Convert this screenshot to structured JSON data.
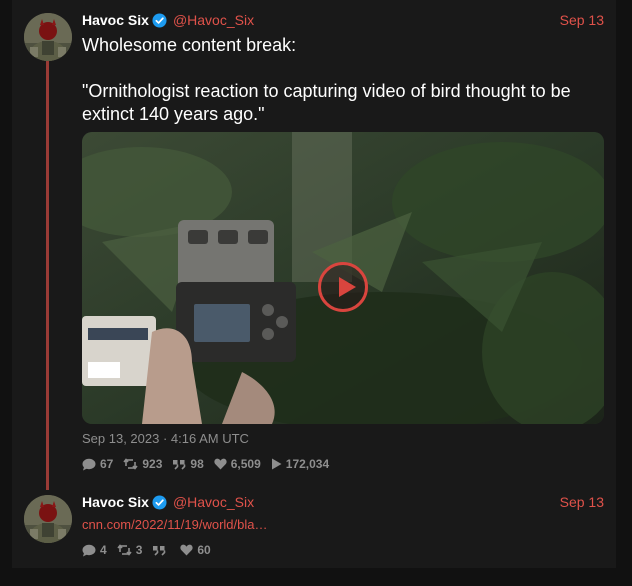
{
  "posts": [
    {
      "name": "Havoc Six",
      "handle": "@Havoc_Six",
      "date": "Sep 13",
      "text_line1": "Wholesome content break:",
      "text_line2": "\"Ornithologist reaction to capturing video of bird thought to be extinct 140 years ago.\"",
      "timestamp": "Sep 13, 2023 · 4:16 AM UTC",
      "stats": {
        "replies": "67",
        "retweets": "923",
        "quotes": "98",
        "likes": "6,509",
        "views": "172,034"
      }
    },
    {
      "name": "Havoc Six",
      "handle": "@Havoc_Six",
      "date": "Sep 13",
      "link": "cnn.com/2022/11/19/world/bla…",
      "stats": {
        "replies": "4",
        "retweets": "3",
        "quotes": "",
        "likes": "60"
      }
    }
  ],
  "icons": {
    "verified": "verified-badge-icon",
    "reply": "comment-icon",
    "retweet": "retweet-icon",
    "quote": "quote-icon",
    "like": "heart-icon",
    "views": "play-icon"
  },
  "colors": {
    "accent": "#e0524a",
    "verified": "#1d9bf0",
    "thread_line": "#9a3b36",
    "muted": "#8e8e8e",
    "panel": "#191919"
  }
}
